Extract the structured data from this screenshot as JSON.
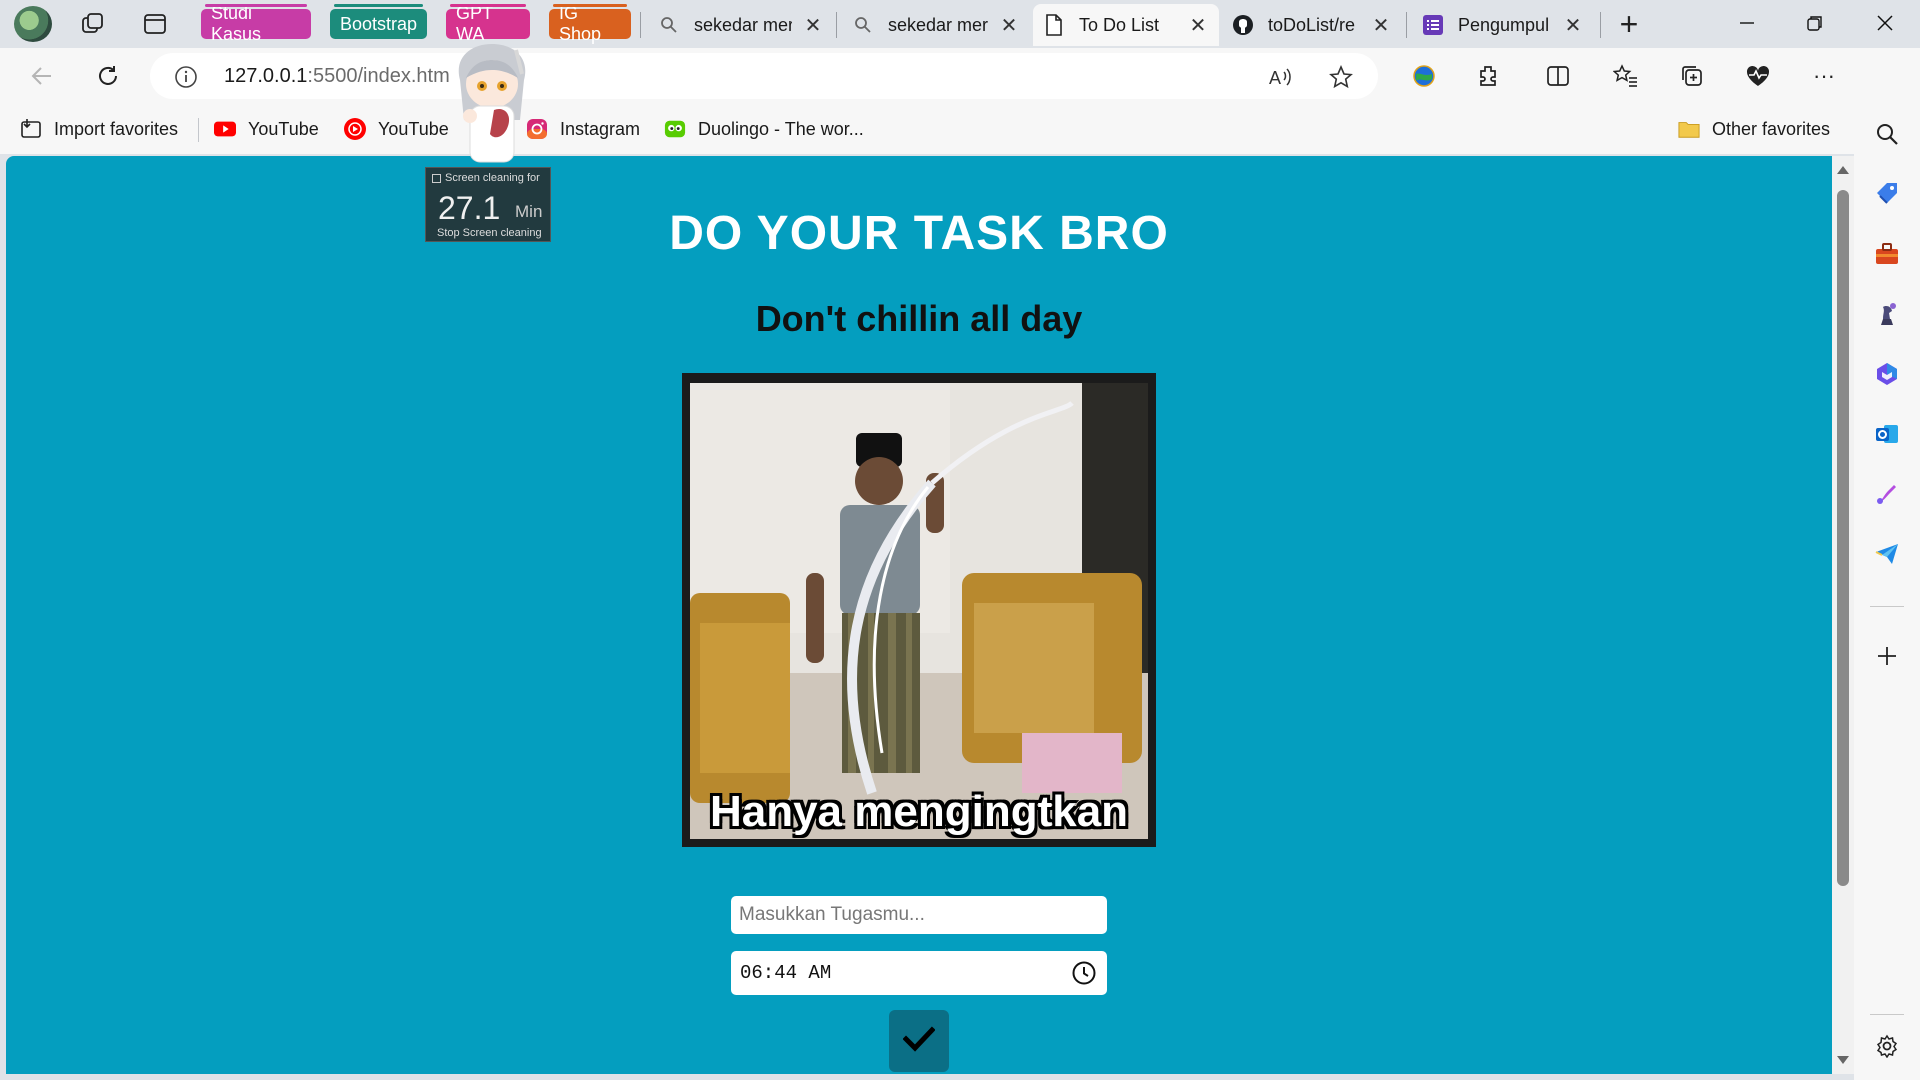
{
  "tabstrip": {
    "groups": [
      {
        "label": "Studi Kasus",
        "color": "#c73ca6"
      },
      {
        "label": "Bootstrap",
        "color": "#1c8c7c"
      },
      {
        "label": "GPT WA",
        "color": "#d6338e"
      },
      {
        "label": "IG Shop",
        "color": "#d9611f"
      }
    ],
    "tabs": [
      {
        "title": "sekedar mer",
        "icon": "search-icon"
      },
      {
        "title": "sekedar mer",
        "icon": "search-icon"
      },
      {
        "title": "To Do List",
        "icon": "document-icon",
        "active": true
      },
      {
        "title": "toDoList/re",
        "icon": "github-icon"
      },
      {
        "title": "Pengumpul",
        "icon": "forms-icon"
      }
    ],
    "close_glyph": "✕",
    "new_tab_glyph": "+"
  },
  "address": {
    "url_host": "127.0.0.1",
    "url_rest": ":5500/index.htm"
  },
  "favorites": {
    "items": [
      {
        "label": "Import favorites",
        "icon": "import-icon"
      },
      {
        "label": "YouTube",
        "icon": "youtube-icon"
      },
      {
        "label": "YouTube",
        "icon": "youtube-music-icon"
      },
      {
        "label": "Instagram",
        "icon": "instagram-icon"
      },
      {
        "label": "Duolingo - The wor...",
        "icon": "duolingo-icon"
      }
    ],
    "other": "Other favorites"
  },
  "page": {
    "title": "DO YOUR TASK BRO",
    "subtitle": "Don't chillin all day",
    "meme_caption": "Hanya mengingtkan",
    "task_placeholder": "Masukkan Tugasmu...",
    "time_value": "06:44 AM",
    "background": "#049ebf",
    "button_color": "#0b6f86"
  },
  "widget": {
    "header": "Screen cleaning for",
    "value": "27.1",
    "unit": "Min",
    "stop": "Stop Screen cleaning"
  }
}
